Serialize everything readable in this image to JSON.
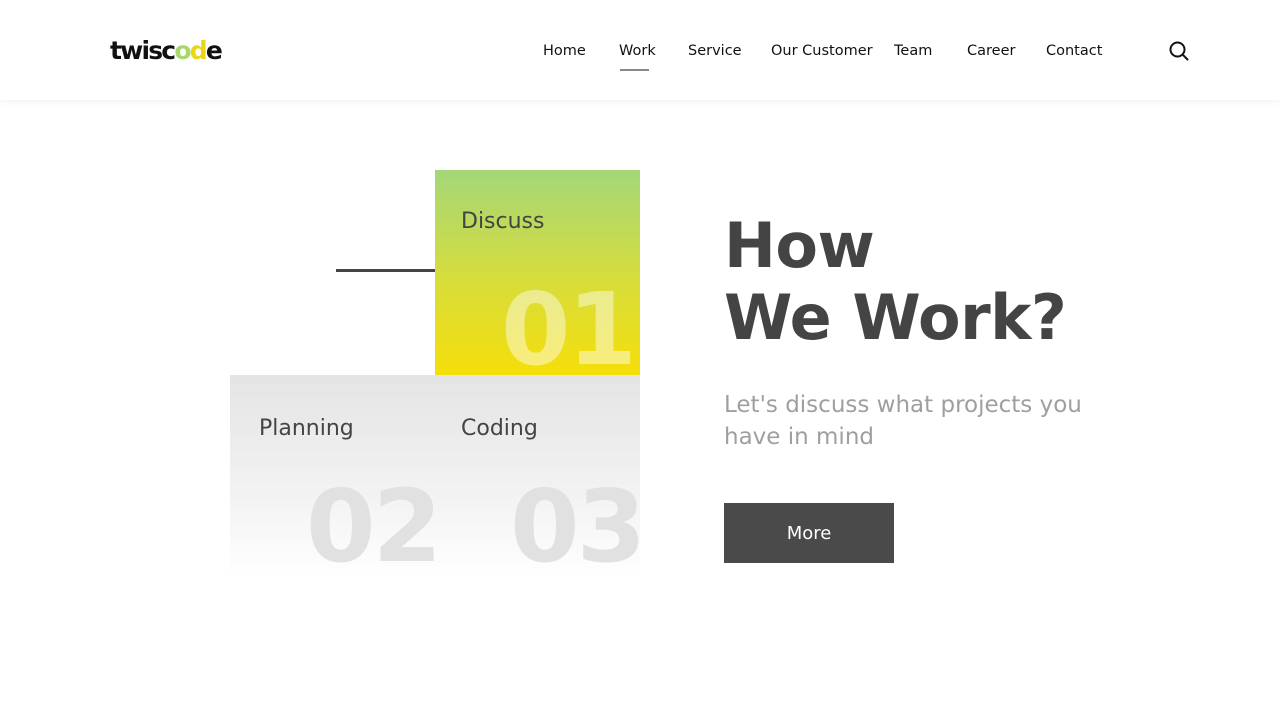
{
  "brand": {
    "logo_text_parts": [
      "twisc",
      "o",
      "d",
      "e"
    ]
  },
  "nav": {
    "items": [
      "Home",
      "Work",
      "Service",
      "Our Customer",
      "Team",
      "Career",
      "Contact"
    ],
    "active": "Work"
  },
  "steps": [
    {
      "label": "Discuss",
      "number": "01"
    },
    {
      "label": "Planning",
      "number": "02"
    },
    {
      "label": "Coding",
      "number": "03"
    }
  ],
  "hero": {
    "title_line1": "How",
    "title_line2": "We Work?",
    "subtitle": "Let's discuss what projects you have in mind",
    "button_label": "More"
  },
  "colors": {
    "accent_green": "#a4d779",
    "accent_yellow": "#f5de0a",
    "dark": "#444444",
    "button_bg": "#4a4a4a"
  },
  "icons": [
    "search-icon"
  ]
}
